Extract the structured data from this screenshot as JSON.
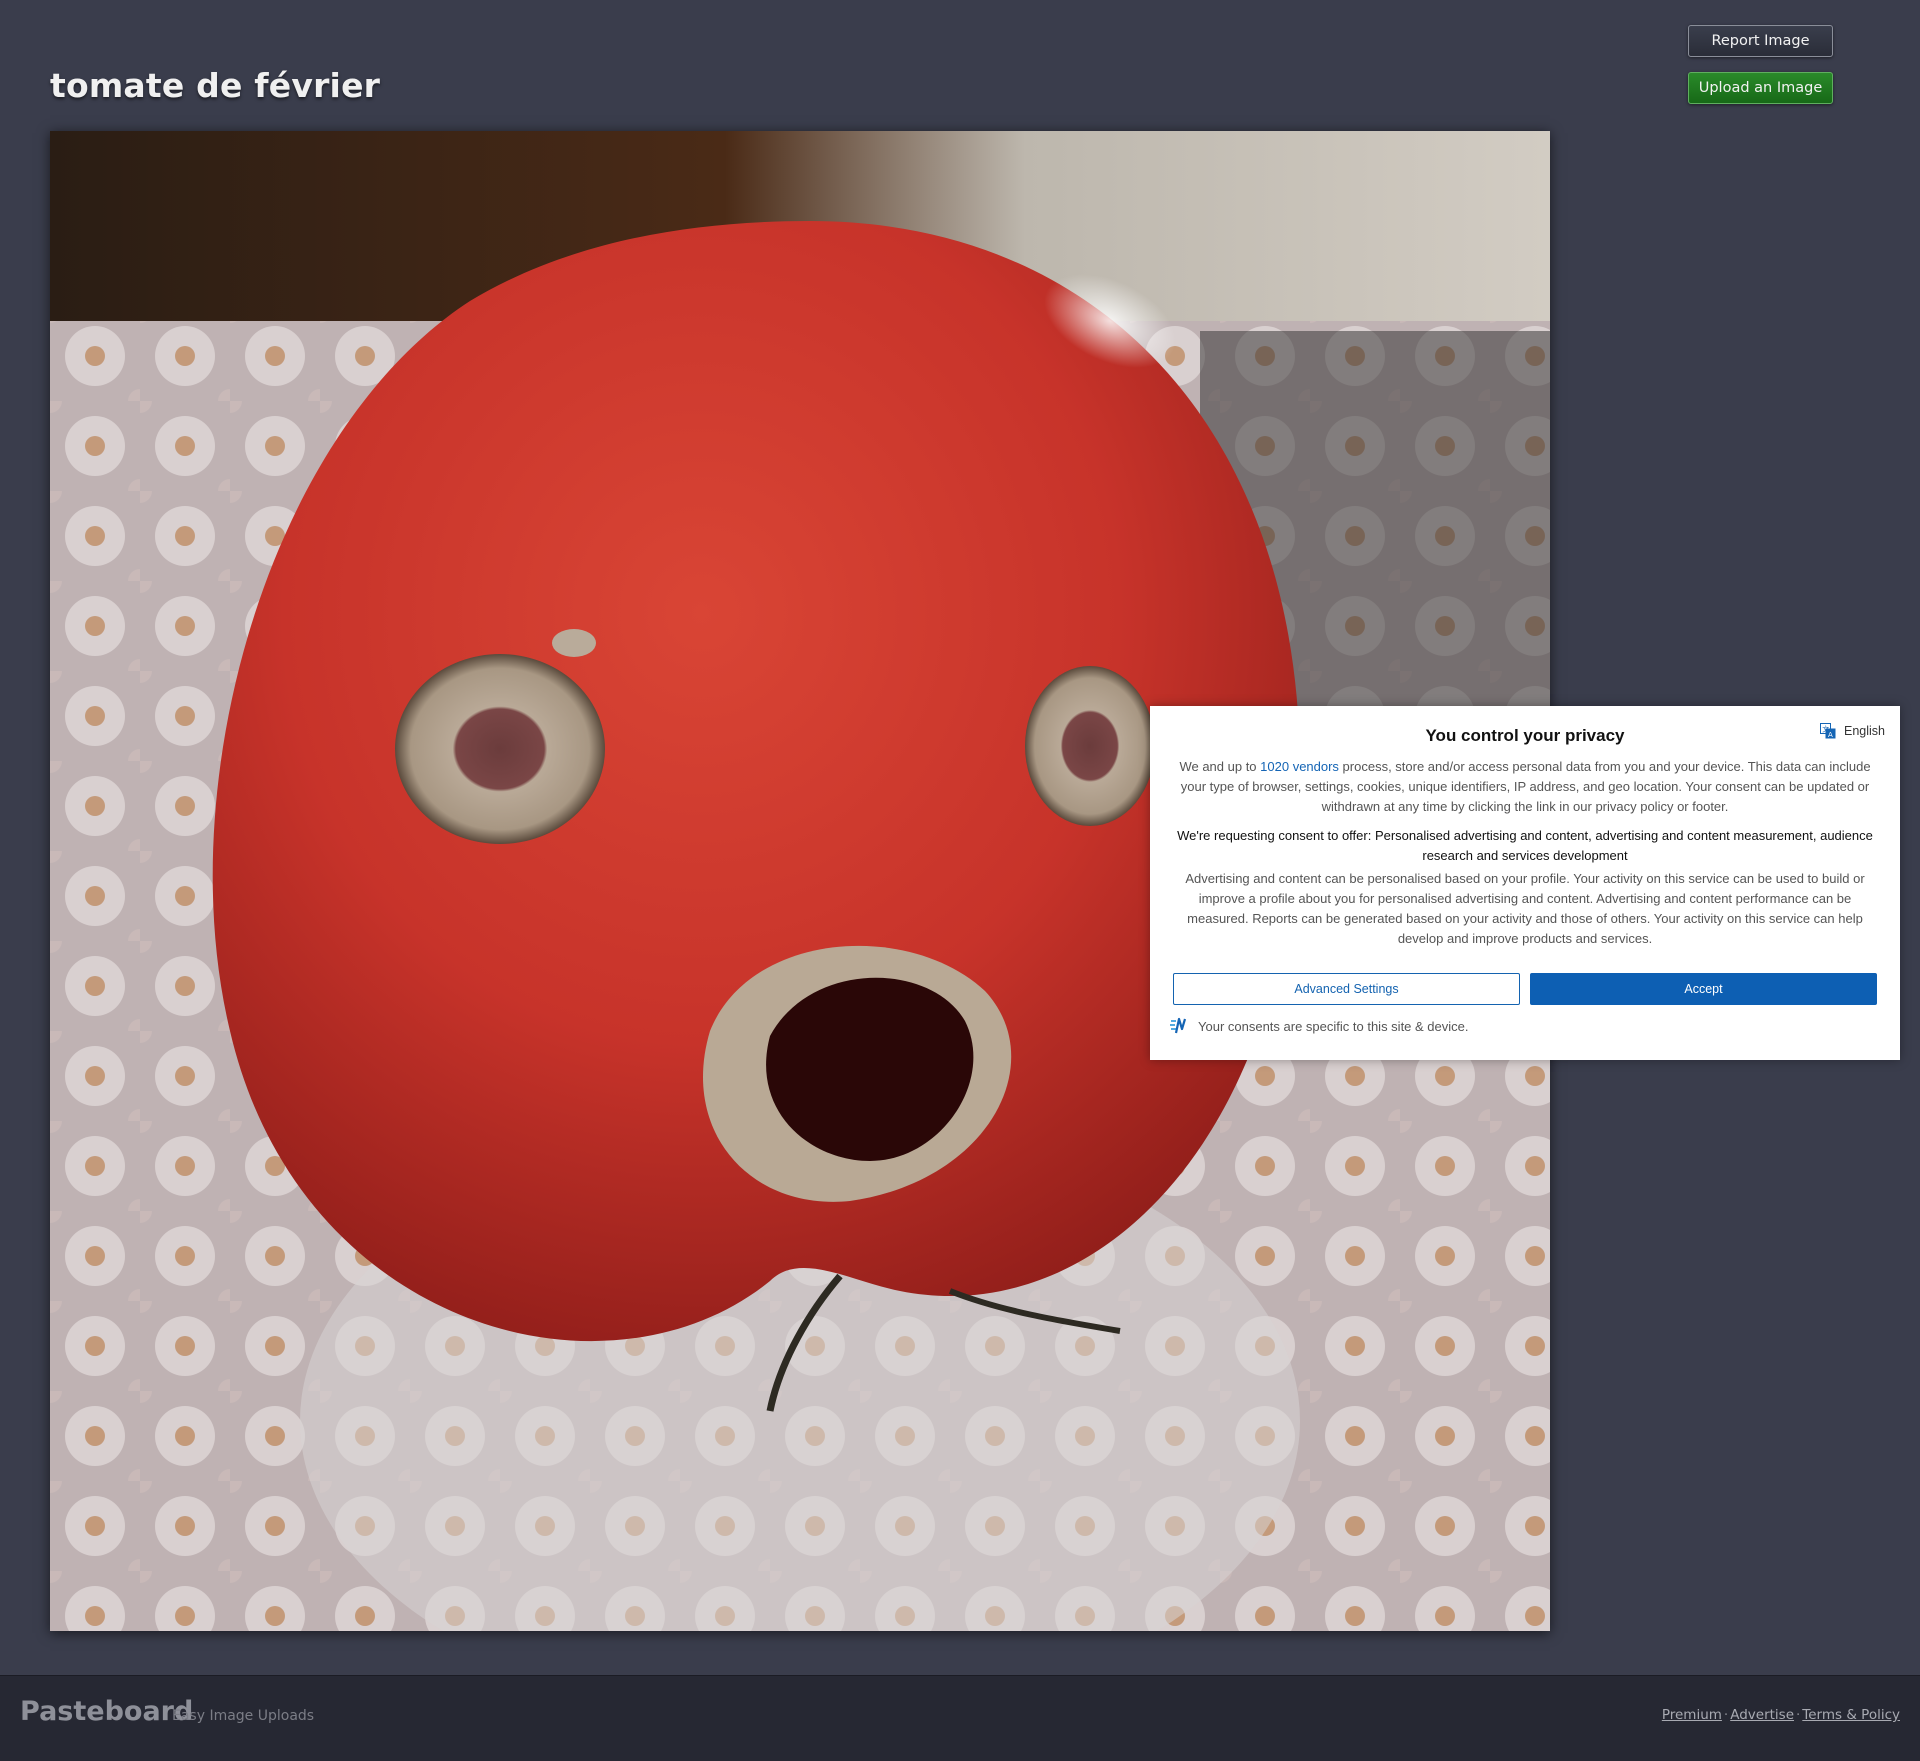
{
  "page": {
    "title": "tomate de février"
  },
  "actions": {
    "report_label": "Report Image",
    "upload_label": "Upload an Image"
  },
  "image": {
    "icon": "photo"
  },
  "consent": {
    "title": "You control your privacy",
    "language": "English",
    "intro_prefix": "We and up to ",
    "vendors_link": "1020 vendors",
    "intro_suffix": " process, store and/or access personal data from you and your device. This data can include your type of browser, settings, cookies, unique identifiers, IP address, and geo location. Your consent can be updated or withdrawn at any time by clicking the link in our privacy policy or footer.",
    "purposes": "We're requesting consent to offer: Personalised advertising and content, advertising and content measurement, audience research and services development",
    "details": "Advertising and content can be personalised based on your profile. Your activity on this service can be used to build or improve a profile about you for personalised advertising and content. Advertising and content performance can be measured. Reports can be generated based on your activity and those of others. Your activity on this service can help develop and improve products and services.",
    "advanced_label": "Advanced Settings",
    "accept_label": "Accept",
    "footer_note": "Your consents are specific to this site & device.",
    "colors": {
      "primary": "#0d5fb3"
    }
  },
  "footer": {
    "logo": "Pasteboard",
    "tagline": "Easy Image Uploads",
    "links": [
      "Premium",
      "Advertise",
      "Terms & Policy"
    ],
    "separator": "·"
  },
  "colors": {
    "background": "#3a3d4c",
    "upload_button": "#1f7a1f",
    "footer": "#262833"
  }
}
